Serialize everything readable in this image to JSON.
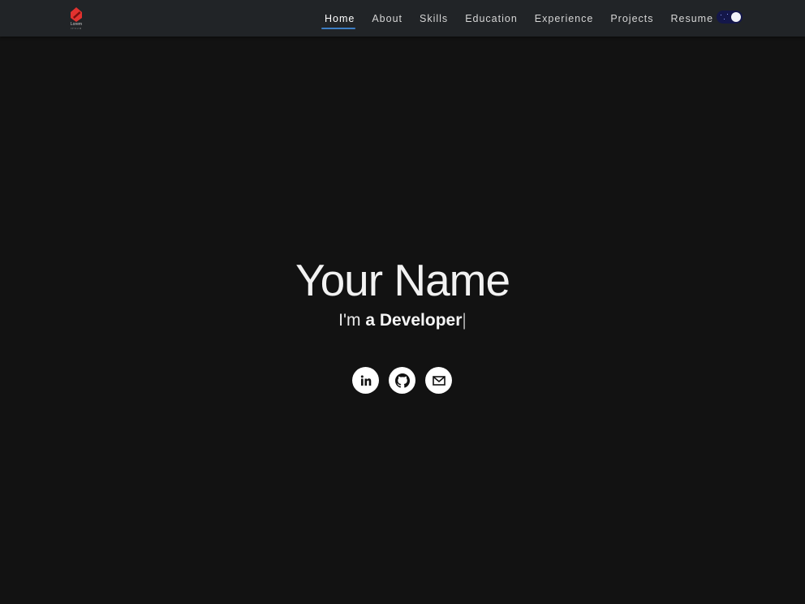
{
  "navbar": {
    "logo": {
      "text": "Lorem",
      "subtext": "IPSUM",
      "brand_color": "#e2322f"
    },
    "links": [
      {
        "label": "Home",
        "active": true
      },
      {
        "label": "About",
        "active": false
      },
      {
        "label": "Skills",
        "active": false
      },
      {
        "label": "Education",
        "active": false
      },
      {
        "label": "Experience",
        "active": false
      },
      {
        "label": "Projects",
        "active": false
      },
      {
        "label": "Resume",
        "active": false
      }
    ],
    "theme_toggle": {
      "state": "dark",
      "icon": "theme-toggle-icon"
    },
    "accent_color": "#3d7ec4"
  },
  "hero": {
    "name": "Your Name",
    "tagline_prefix": "I'm ",
    "tagline_role": "a Developer",
    "cursor": "|",
    "socials": [
      {
        "name": "LinkedIn",
        "icon": "linkedin-icon"
      },
      {
        "name": "GitHub",
        "icon": "github-icon"
      },
      {
        "name": "Email",
        "icon": "mail-icon"
      }
    ]
  }
}
